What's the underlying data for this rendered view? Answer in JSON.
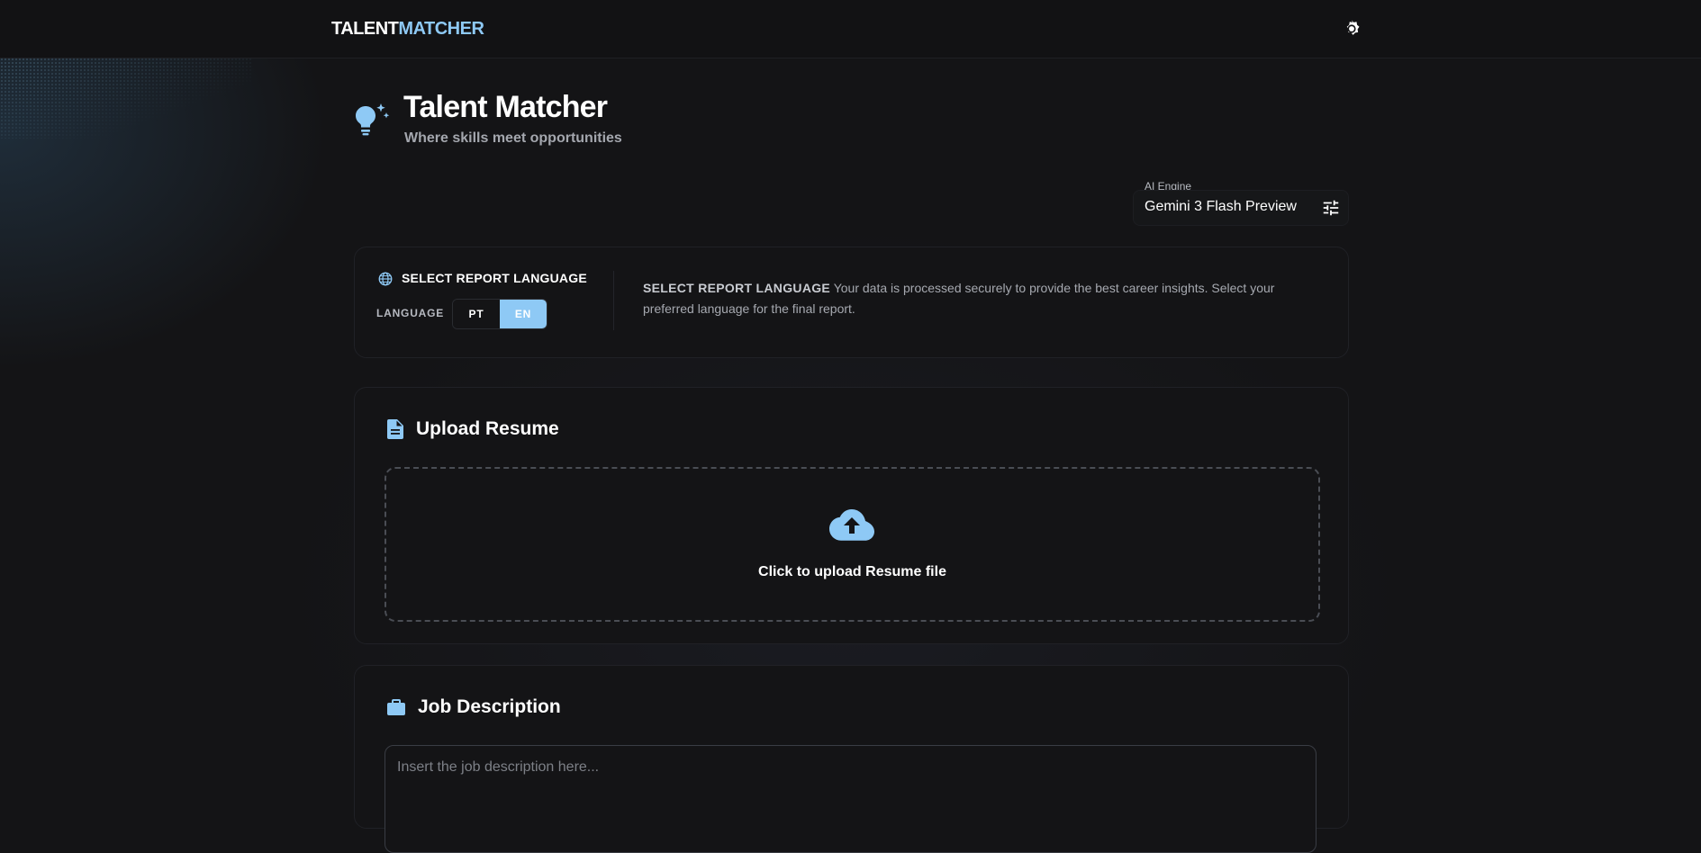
{
  "brand": {
    "part1": "TALENT",
    "part2": "MATCHER"
  },
  "header": {
    "theme_icon": "gear-sun-icon"
  },
  "hero": {
    "title": "Talent Matcher",
    "subtitle": "Where skills meet opportunities",
    "icon": "lightbulb-sparkle-icon"
  },
  "engine": {
    "label": "AI Engine",
    "value": "Gemini 3 Flash Preview",
    "icon": "tune-sliders-icon"
  },
  "language": {
    "title": "SELECT REPORT LANGUAGE",
    "label": "LANGUAGE",
    "options": [
      "PT",
      "EN"
    ],
    "selected": "EN",
    "desc_title": "SELECT REPORT LANGUAGE",
    "desc_text": " Your data is processed securely to provide the best career insights. Select your preferred language for the final report."
  },
  "upload": {
    "title": "Upload Resume",
    "cta": "Click to upload Resume file",
    "icon": "cloud-upload-icon"
  },
  "job": {
    "title": "Job Description",
    "placeholder": "Insert the job description here...",
    "value": ""
  },
  "colors": {
    "accent": "#8ec9f5",
    "background": "#141416",
    "card_border": "#202126"
  }
}
